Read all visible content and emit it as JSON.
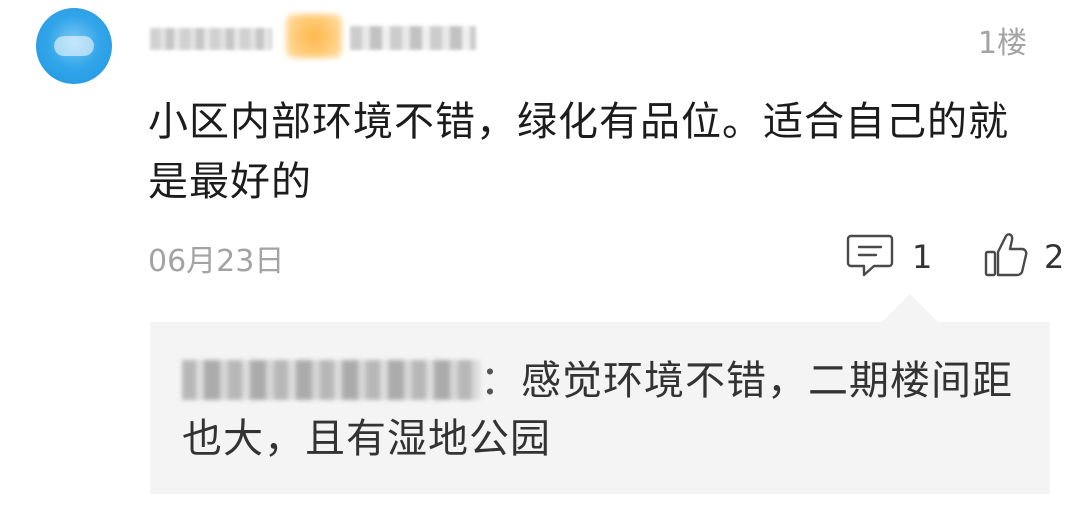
{
  "comment": {
    "floor": "1楼",
    "content": "小区内部环境不错，绿化有品位。适合自己的就是最好的",
    "date": "06月23日",
    "reply_count": "1",
    "like_count": "2",
    "reply_icon": "comment-bubble-icon",
    "like_icon": "thumbs-up-icon"
  },
  "reply": {
    "separator": "：",
    "text": "感觉环境不错，二期楼间距也大，且有湿地公园"
  },
  "colors": {
    "avatar": "#33a6ea",
    "muted_text": "#a3a3a3",
    "reply_background": "#f4f4f4"
  }
}
